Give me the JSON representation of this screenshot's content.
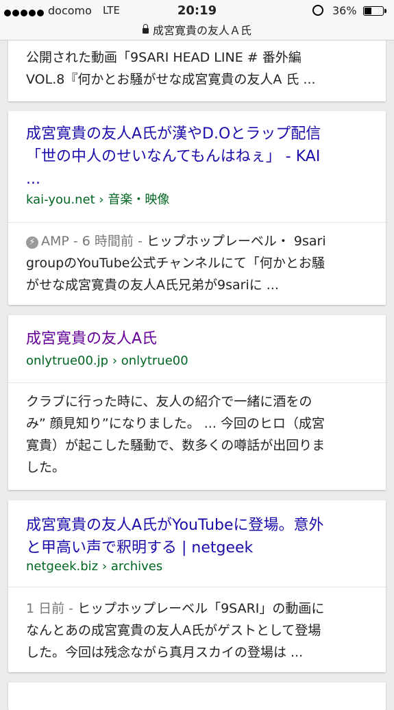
{
  "status": {
    "carrier": "docomo",
    "network": "LTE",
    "time": "20:19",
    "battery": "36%",
    "battery_level": 0.36
  },
  "address_bar": {
    "title": "成宮寛貴の友人Ａ氏"
  },
  "results": [
    {
      "snippet_top": "公開された動画「9SARI HEAD LINE # 番外編",
      "snippet_bottom": "VOL.8『何かとお騒がせな成宮寛貴の友人A 氏 ..."
    },
    {
      "title_l1": "成宮寛貴の友人A氏が漢やD.Oとラップ配信",
      "title_l2": "「世の中人のせいなんてもんはねぇ」 - KAI",
      "title_l3": "...",
      "url_domain": "kai-you.net",
      "url_path": "音楽・映像",
      "meta_amp": "AMP",
      "meta_time": "6 時間前",
      "snippet_l1": "ヒップホップレーベル・ 9sari",
      "snippet_l2": "groupのYouTube公式チャンネルにて「何かとお騒",
      "snippet_l3": "がせな成宮寛貴の友人A氏兄弟が9sariに ..."
    },
    {
      "title_l1": "成宮寛貴の友人A氏",
      "url_domain": "onlytrue00.jp",
      "url_path": "onlytrue00",
      "snippet_l1": "クラブに行った時に、友人の紹介で一緒に酒をの",
      "snippet_l2": "み” 顔見知り”になりました。 ... 今回のヒロ（成宮",
      "snippet_l3": "寛貴）が起こした騒動で、数多くの噂話が出回りま",
      "snippet_l4": "した。"
    },
    {
      "title_l1": "成宮寛貴の友人A氏がYouTubeに登場。意外",
      "title_l2": "と甲高い声で釈明する | netgeek",
      "url_domain": "netgeek.biz",
      "url_path": "archives",
      "meta_time": "1 日前",
      "snippet_l1": "ヒップホップレーベル「9SARI」の動画に",
      "snippet_l2": "なんとあの成宮寛貴の友人A氏がゲストとして登場",
      "snippet_l3": "した。今回は残念ながら真月スカイの登場は ..."
    }
  ],
  "separator": "›",
  "dash": " - "
}
